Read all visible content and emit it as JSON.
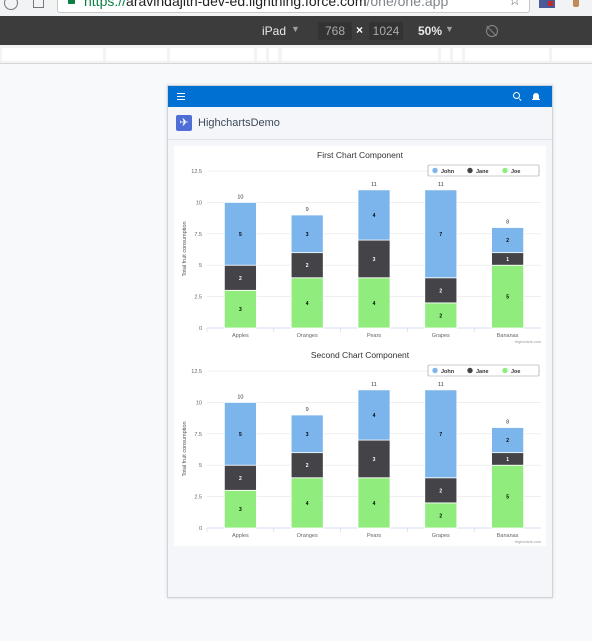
{
  "browser": {
    "url_scheme": "https://",
    "url_host": "aravindajith-dev-ed.lightning.force.com",
    "url_path": "/one/one.app"
  },
  "device_toolbar": {
    "device": "iPad",
    "width": "768",
    "times": "×",
    "height": "1024",
    "zoom": "50%"
  },
  "app": {
    "name": "HighchartsDemo"
  },
  "colors": {
    "john": "#7cb5ec",
    "jane": "#434348",
    "joe": "#90ed7d",
    "sf_blue": "#0070d2"
  },
  "chart_data": [
    {
      "type": "bar",
      "stacked": true,
      "title": "First Chart Component",
      "xlabel": "",
      "ylabel": "Total fruit consumption",
      "categories": [
        "Apples",
        "Oranges",
        "Pears",
        "Grapes",
        "Bananas"
      ],
      "series": [
        {
          "name": "John",
          "values": [
            5,
            3,
            4,
            7,
            2
          ]
        },
        {
          "name": "Jane",
          "values": [
            2,
            2,
            3,
            2,
            1
          ]
        },
        {
          "name": "Joe",
          "values": [
            3,
            4,
            4,
            2,
            5
          ]
        }
      ],
      "totals": [
        10,
        9,
        11,
        11,
        8
      ],
      "ylim": [
        0,
        12.5
      ],
      "yticks": [
        "0",
        "2.5",
        "5",
        "7.5",
        "10",
        "12.5"
      ],
      "grid": true,
      "legend_position": "top-right",
      "credit": "Highcharts.com"
    },
    {
      "type": "bar",
      "stacked": true,
      "title": "Second Chart Component",
      "xlabel": "",
      "ylabel": "Total fruit consumption",
      "categories": [
        "Apples",
        "Oranges",
        "Pears",
        "Grapes",
        "Bananas"
      ],
      "series": [
        {
          "name": "John",
          "values": [
            5,
            3,
            4,
            7,
            2
          ]
        },
        {
          "name": "Jane",
          "values": [
            2,
            2,
            3,
            2,
            1
          ]
        },
        {
          "name": "Joe",
          "values": [
            3,
            4,
            4,
            2,
            5
          ]
        }
      ],
      "totals": [
        10,
        9,
        11,
        11,
        8
      ],
      "ylim": [
        0,
        12.5
      ],
      "yticks": [
        "0",
        "2.5",
        "5",
        "7.5",
        "10",
        "12.5"
      ],
      "grid": true,
      "legend_position": "top-right",
      "credit": "Highcharts.com"
    }
  ]
}
